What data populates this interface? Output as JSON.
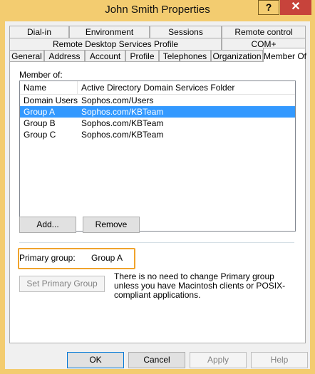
{
  "window": {
    "title": "John Smith Properties",
    "help_label": "?",
    "close_label": "✕"
  },
  "tabs": {
    "row1": [
      "Dial-in",
      "Environment",
      "Sessions",
      "Remote control"
    ],
    "row2": [
      "Remote Desktop Services Profile",
      "COM+"
    ],
    "row3": [
      "General",
      "Address",
      "Account",
      "Profile",
      "Telephones",
      "Organization",
      "Member Of"
    ],
    "active": "Member Of"
  },
  "member_of": {
    "label": "Member of:",
    "columns": [
      "Name",
      "Active Directory Domain Services Folder"
    ],
    "rows": [
      {
        "name": "Domain Users",
        "folder": "Sophos.com/Users"
      },
      {
        "name": "Group A",
        "folder": "Sophos.com/KBTeam"
      },
      {
        "name": "Group B",
        "folder": "Sophos.com/KBTeam"
      },
      {
        "name": "Group C",
        "folder": "Sophos.com/KBTeam"
      }
    ],
    "selected_index": 1
  },
  "buttons": {
    "add": "Add...",
    "remove": "Remove",
    "set_primary": "Set Primary Group",
    "ok": "OK",
    "cancel": "Cancel",
    "apply": "Apply",
    "help": "Help"
  },
  "primary_group": {
    "label": "Primary group:",
    "value": "Group A",
    "note": "There is no need to change Primary group unless you have Macintosh clients or POSIX-compliant applications."
  },
  "colors": {
    "titlebar": "#f3cc70",
    "close": "#c7433b",
    "selection": "#3399ff",
    "highlight": "#f0a32c"
  }
}
